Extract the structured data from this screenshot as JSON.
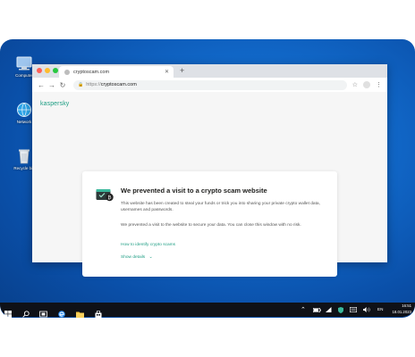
{
  "desktop": {
    "icons": [
      {
        "label": "Computer"
      },
      {
        "label": "Network"
      },
      {
        "label": "Recycle bin"
      }
    ]
  },
  "browser": {
    "tab_title": "cryptoscam.com",
    "url_prefix": "https://",
    "url_host": "cryptoscam.com"
  },
  "page": {
    "brand": "kaspersky",
    "heading": "We prevented a visit to a crypto scam website",
    "paragraph1": "This website has been created to steal your funds or trick you into sharing your private crypto wallet data, usernames and passwords.",
    "paragraph2": "We prevented a visit to the website to secure your data. You can close this window with no risk.",
    "link": "How to identify crypto scams",
    "details": "Show details"
  },
  "taskbar": {
    "language": "EN",
    "time": "16:51",
    "date": "18.01.2023"
  },
  "colors": {
    "accent": "#1f9e84",
    "desktop": "#1168c9",
    "taskbar": "#0f1117"
  }
}
